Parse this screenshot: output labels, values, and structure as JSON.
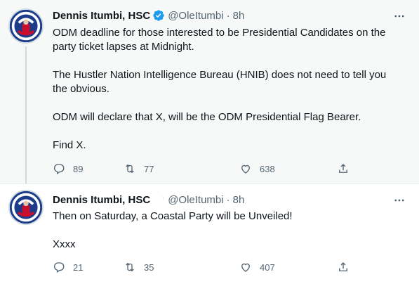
{
  "tweets": [
    {
      "author": {
        "display_name": "Dennis Itumbi, HSC",
        "handle": "@OleItumbi",
        "verified": true
      },
      "separator": "·",
      "time": "8h",
      "paragraphs": [
        "ODM deadline for those interested to be Presidential Candidates on the party ticket lapses at Midnight.",
        "The Hustler Nation Intelligence Bureau (HNIB) does not need to tell you the obvious.",
        "ODM will declare that X, will be the ODM Presidential Flag Bearer.",
        "Find X."
      ],
      "stats": {
        "replies": "89",
        "retweets": "77",
        "likes": "638"
      }
    },
    {
      "author": {
        "display_name": "Dennis Itumbi, HSC",
        "handle": "@OleItumbi",
        "verified": true
      },
      "separator": "·",
      "time": "8h",
      "paragraphs": [
        "Then on Saturday, a Coastal Party will be Unveiled!",
        "Xxxx"
      ],
      "stats": {
        "replies": "21",
        "retweets": "35",
        "likes": "407"
      }
    }
  ],
  "avatar": {
    "badge_text": "I'VE GOT",
    "badge_text_bottom": "YOUR BACK"
  },
  "colors": {
    "text": "#0f1419",
    "secondary": "#536471",
    "verified": "#1d9bf0",
    "avatar_bg": "#1d3b8b",
    "thread_bg": "#f7f9f9"
  },
  "icons": [
    "verified-badge-icon",
    "more-icon",
    "reply-icon",
    "retweet-icon",
    "like-icon",
    "share-icon"
  ]
}
